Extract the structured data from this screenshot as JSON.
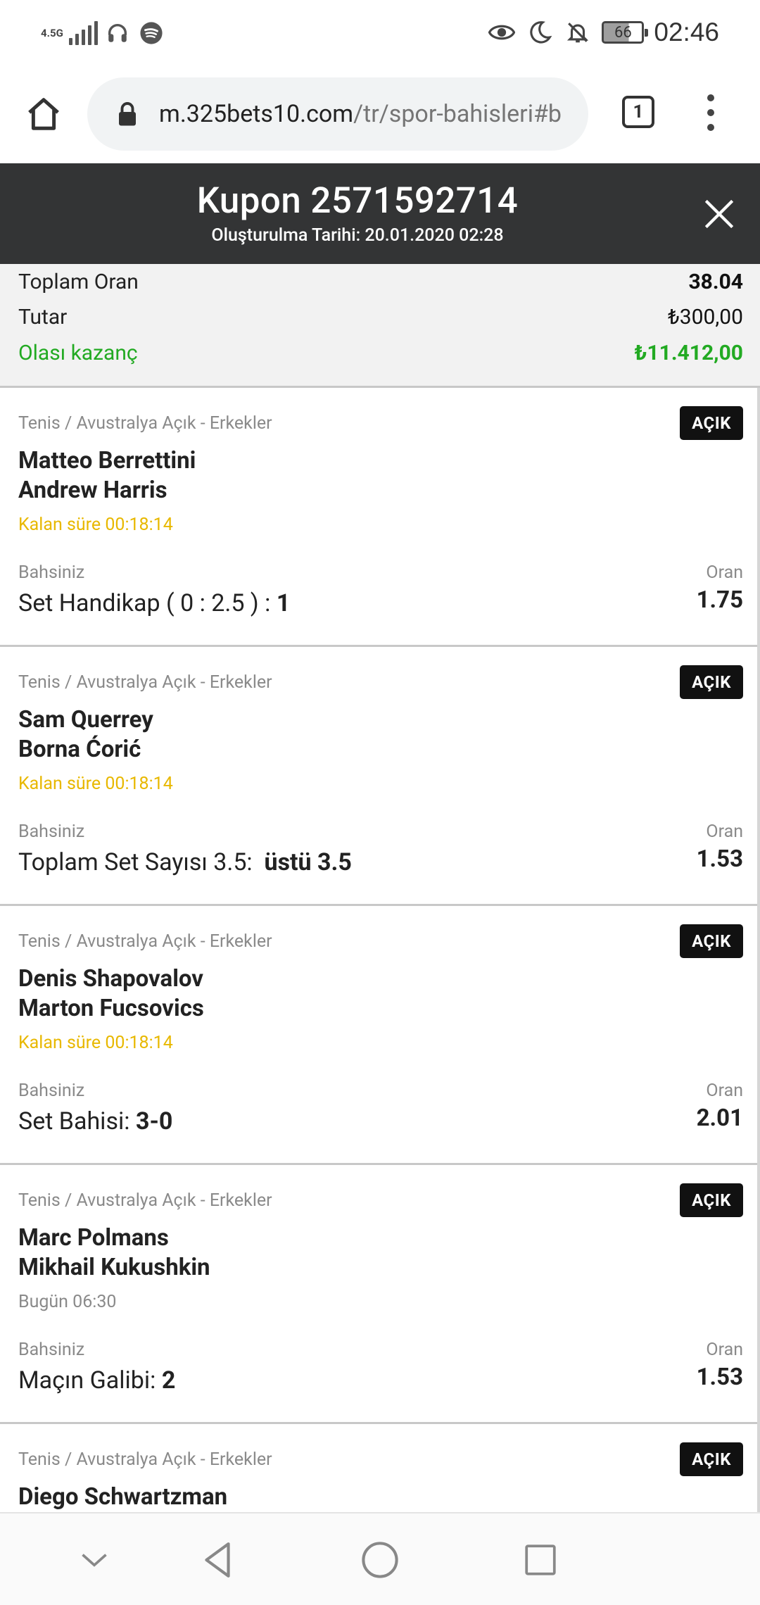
{
  "status_bar": {
    "network": "4.5G",
    "time": "02:46",
    "battery": "66",
    "icons": [
      "signal-icon",
      "headphones-icon",
      "spotify-icon",
      "eye-icon",
      "moon-icon",
      "bell-off-icon",
      "battery-icon"
    ]
  },
  "browser": {
    "url_host": "m.325bets10.com",
    "url_path": "/tr/spor-bahisleri#b",
    "tab_count": "1"
  },
  "coupon": {
    "title": "Kupon 2571592714",
    "created": "Oluşturulma Tarihi: 20.01.2020 02:28"
  },
  "summary": {
    "total_odds_label": "Toplam Oran",
    "total_odds_value": "38.04",
    "amount_label": "Tutar",
    "amount_value": "₺300,00",
    "possible_win_label": "Olası kazanç",
    "possible_win_value": "₺11.412,00"
  },
  "labels": {
    "your_bet": "Bahsiniz",
    "odds": "Oran"
  },
  "bets": [
    {
      "category": "Tenis / Avustralya Açık - Erkekler",
      "status": "AÇIK",
      "team1": "Matteo Berrettini",
      "team2": "Andrew Harris",
      "time": "Kalan süre 00:18:14",
      "pick": "Set Handikap ( 0 : 2.5 ) : ",
      "pick_bold": "1",
      "odds": "1.75"
    },
    {
      "category": "Tenis / Avustralya Açık - Erkekler",
      "status": "AÇIK",
      "team1": "Sam Querrey",
      "team2": "Borna Ćorić",
      "time": "Kalan süre 00:18:14",
      "pick": "Toplam Set Sayısı 3.5:  ",
      "pick_bold": "üstü 3.5",
      "odds": "1.53"
    },
    {
      "category": "Tenis / Avustralya Açık - Erkekler",
      "status": "AÇIK",
      "team1": "Denis Shapovalov",
      "team2": "Marton Fucsovics",
      "time": "Kalan süre 00:18:14",
      "pick": "Set Bahisi: ",
      "pick_bold": "3-0",
      "odds": "2.01"
    },
    {
      "category": "Tenis / Avustralya Açık - Erkekler",
      "status": "AÇIK",
      "team1": "Marc Polmans",
      "team2": "Mikhail Kukushkin",
      "time": "Bugün 06:30",
      "pick": "Maçın Galibi: ",
      "pick_bold": "2",
      "odds": "1.53"
    },
    {
      "category": "Tenis / Avustralya Açık - Erkekler",
      "status": "AÇIK",
      "team1": "Diego Schwartzman"
    }
  ]
}
